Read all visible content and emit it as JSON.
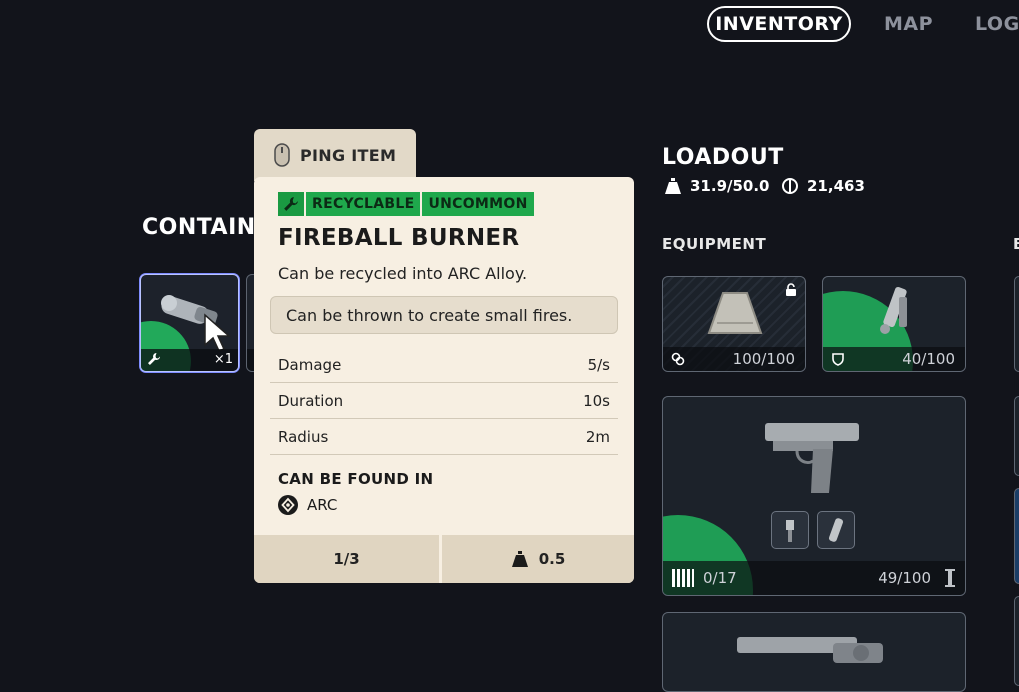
{
  "nav": {
    "tabs": [
      {
        "label": "INVENTORY",
        "active": true
      },
      {
        "label": "MAP",
        "active": false
      },
      {
        "label": "LOGI",
        "active": false
      }
    ]
  },
  "container": {
    "title": "CONTAINI",
    "slot": {
      "count": "×1"
    }
  },
  "tooltip": {
    "ping_label": "PING ITEM",
    "tags": [
      "RECYCLABLE",
      "UNCOMMON"
    ],
    "name": "FIREBALL BURNER",
    "recycle_text": "Can be recycled into ARC Alloy.",
    "description": "Can be thrown to create small fires.",
    "stats": [
      {
        "label": "Damage",
        "value": "5/s"
      },
      {
        "label": "Duration",
        "value": "10s"
      },
      {
        "label": "Radius",
        "value": "2m"
      }
    ],
    "found_in_title": "CAN BE FOUND IN",
    "found_in": "ARC",
    "stack": "1/3",
    "weight": "0.5"
  },
  "loadout": {
    "title": "LOADOUT",
    "weight": "31.9/50.0",
    "coins": "21,463",
    "equipment_title": "EQUIPMENT",
    "augment_durability": "100/100",
    "shield_durability": "40/100",
    "weapon_ammo": "0/17",
    "weapon_durability": "49/100"
  },
  "colors": {
    "background": "#12141b",
    "uncommon_green": "#1fa84c",
    "tooltip_bg": "#f7efe2",
    "footer_bg": "#e0d5c1"
  }
}
